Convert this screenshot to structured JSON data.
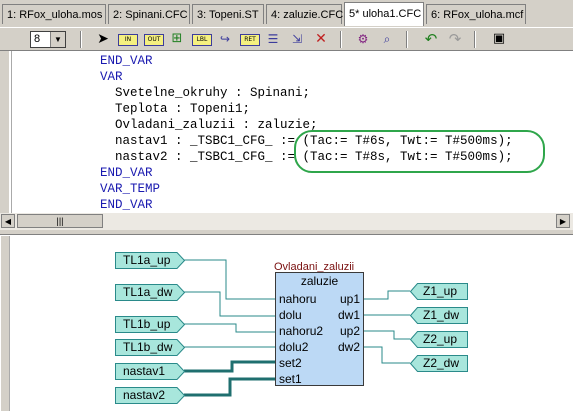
{
  "tabs": [
    {
      "label": "1: RFox_uloha.mos"
    },
    {
      "label": "2: Spinani.CFC"
    },
    {
      "label": "3: Topeni.ST"
    },
    {
      "label": "4: zaluzie.CFC"
    },
    {
      "label": "5* uloha1.CFC"
    },
    {
      "label": "6: RFox_uloha.mcf"
    }
  ],
  "active_tab": "5* uloha1.CFC",
  "toolbar": {
    "zoom_value": "8",
    "buttons": [
      {
        "name": "select",
        "label": ""
      },
      {
        "name": "input",
        "label": "IN"
      },
      {
        "name": "output",
        "label": "OUT"
      },
      {
        "name": "box",
        "label": ""
      },
      {
        "name": "label",
        "label": "LBL"
      },
      {
        "name": "jump",
        "label": ""
      },
      {
        "name": "return",
        "label": "RET"
      },
      {
        "name": "comment",
        "label": ""
      },
      {
        "name": "insert",
        "label": ""
      },
      {
        "name": "delete",
        "label": ""
      },
      {
        "name": "compile",
        "label": ""
      },
      {
        "name": "find",
        "label": ""
      },
      {
        "name": "undo",
        "label": ""
      },
      {
        "name": "redo",
        "label": ""
      },
      {
        "name": "window",
        "label": ""
      }
    ]
  },
  "code_lines": [
    "END_VAR",
    "VAR",
    "  Svetelne_okruhy : Spinani;",
    "  Teplota : Topeni1;",
    "  Ovladani_zaluzii : zaluzie;",
    "  nastav1 : _TSBC1_CFG_ := (Tac:= T#6s, Twt:= T#500ms);",
    "  nastav2 : _TSBC1_CFG_ := (Tac:= T#8s, Twt:= T#500ms);",
    "END_VAR",
    "VAR_TEMP",
    "END_VAR"
  ],
  "cfc": {
    "inputs": [
      "TL1a_up",
      "TL1a_dw",
      "TL1b_up",
      "TL1b_dw",
      "nastav1",
      "nastav2"
    ],
    "outputs": [
      "Z1_up",
      "Z1_dw",
      "Z2_up",
      "Z2_dw"
    ],
    "block": {
      "instance": "Ovladani_zaluzii",
      "type": "zaluzie",
      "in_pins": [
        "nahoru",
        "dolu",
        "nahoru2",
        "dolu2",
        "set2",
        "set1"
      ],
      "out_pins": [
        "up1",
        "dw1",
        "up2",
        "dw2"
      ]
    }
  },
  "colors": {
    "io_fill": "#a8e6dc",
    "block_fill": "#bcd9f5",
    "wire": "#2a8a8a",
    "highlight": "#2fa64b"
  }
}
